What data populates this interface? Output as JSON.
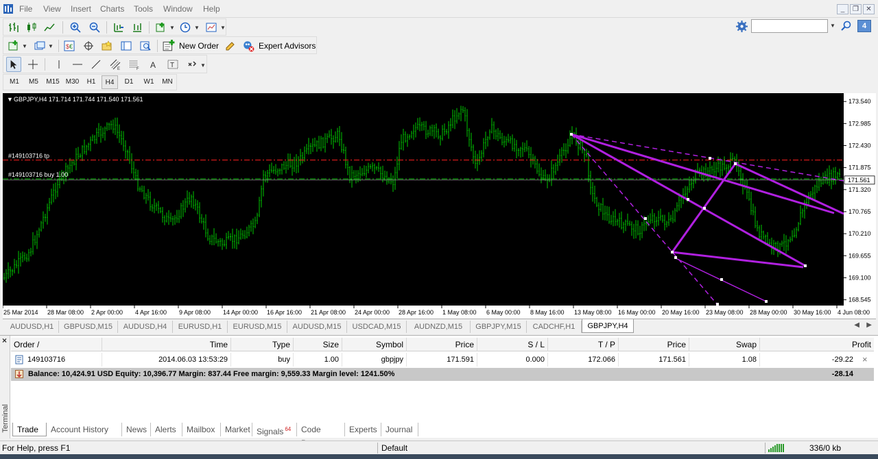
{
  "menu": {
    "items": [
      "File",
      "View",
      "Insert",
      "Charts",
      "Tools",
      "Window",
      "Help"
    ]
  },
  "toolbar": {
    "new_order_label": "New Order",
    "expert_advisors_label": "Expert Advisors",
    "notification_badge": "4"
  },
  "timeframes": [
    "M1",
    "M5",
    "M15",
    "M30",
    "H1",
    "H4",
    "D1",
    "W1",
    "MN"
  ],
  "active_timeframe": "H4",
  "chart": {
    "header": "GBPJPY,H4  171.714 171.744 171.540 171.561",
    "tp_label": "#149103716 tp",
    "order_label": "#149103716 buy 1.00",
    "current_price_label": "171.561",
    "price_labels": [
      "173.540",
      "172.985",
      "172.430",
      "171.875",
      "171.320",
      "170.765",
      "170.210",
      "169.655",
      "169.100",
      "168.545"
    ],
    "time_labels": [
      "25 Mar 2014",
      "28 Mar 08:00",
      "2 Apr 00:00",
      "4 Apr 16:00",
      "9 Apr 08:00",
      "14 Apr 00:00",
      "16 Apr 16:00",
      "21 Apr 08:00",
      "24 Apr 00:00",
      "28 Apr 16:00",
      "1 May 08:00",
      "6 May 00:00",
      "8 May 16:00",
      "13 May 08:00",
      "16 May 00:00",
      "20 May 16:00",
      "23 May 08:00",
      "28 May 00:00",
      "30 May 16:00",
      "4 Jun 08:00"
    ],
    "colors": {
      "background": "#000000",
      "bars": "#00c800",
      "tp_line": "#ff2020",
      "order_line": "#00c800",
      "pitchfork": "#b020e0"
    }
  },
  "chart_data": {
    "type": "ohlc",
    "symbol": "GBPJPY",
    "timeframe": "H4",
    "open": 171.714,
    "high": 171.744,
    "low": 171.54,
    "close": 171.561,
    "ylim": [
      168.4,
      173.75
    ],
    "tp_price": 172.066,
    "order_price": 171.591
  },
  "chart_tabs": [
    "AUDUSD,H1",
    "GBPUSD,M15",
    "AUDUSD,H4",
    "EURUSD,H1",
    "EURUSD,M15",
    "AUDUSD,M15",
    "USDCAD,M15",
    "AUDNZD,M15",
    "GBPJPY,M15",
    "CADCHF,H1",
    "GBPJPY,H4"
  ],
  "active_chart_tab": "GBPJPY,H4",
  "terminal": {
    "side_label": "Terminal",
    "columns": [
      "Order  /",
      "Time",
      "Type",
      "Size",
      "Symbol",
      "Price",
      "S / L",
      "T / P",
      "Price",
      "Swap",
      "Profit"
    ],
    "rows": [
      {
        "order": "149103716",
        "time": "2014.06.03 13:53:29",
        "type": "buy",
        "size": "1.00",
        "symbol": "gbpjpy",
        "price": "171.591",
        "sl": "0.000",
        "tp": "172.066",
        "cur_price": "171.561",
        "swap": "1.08",
        "profit": "-29.22"
      }
    ],
    "balance_line": "Balance: 10,424.91 USD  Equity: 10,396.77  Margin: 837.44  Free margin: 9,559.33  Margin level: 1241.50%",
    "balance_profit": "-28.14",
    "tabs": [
      "Trade",
      "Account History",
      "News",
      "Alerts",
      "Mailbox",
      "Market",
      "Signals",
      "Code Base",
      "Experts",
      "Journal"
    ],
    "signals_badge": "64",
    "active_tab": "Trade"
  },
  "status": {
    "help": "For Help, press F1",
    "profile": "Default",
    "traffic": "336/0 kb"
  }
}
